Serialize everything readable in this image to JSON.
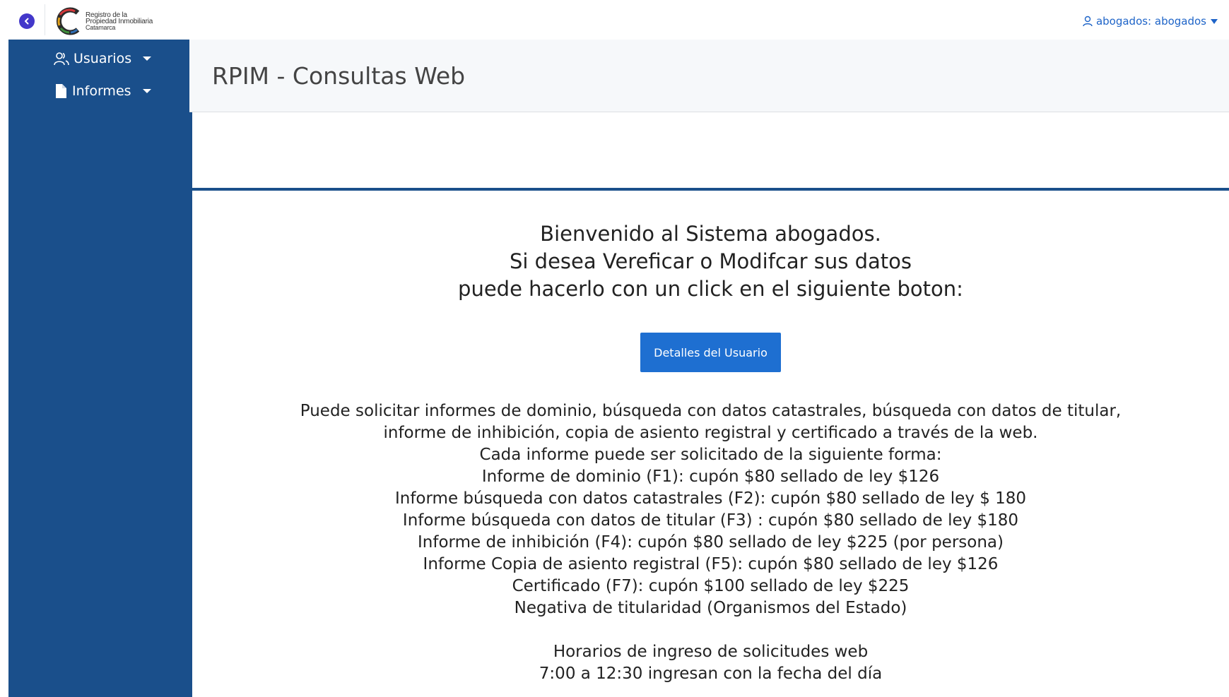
{
  "topbar": {
    "logo_lines": [
      "Registro de la",
      "Propiedad Inmobiliaria",
      "Catamarca"
    ],
    "user_label": "abogados: abogados",
    "icons": {
      "back": "chevron-left-icon",
      "user": "user-icon",
      "dropdown": "caret-down-icon"
    }
  },
  "sidebar": {
    "items": [
      {
        "label": "Usuarios",
        "icon": "users-icon"
      },
      {
        "label": "Informes",
        "icon": "file-icon"
      }
    ]
  },
  "header": {
    "title": "RPIM - Consultas Web"
  },
  "main": {
    "welcome_lines": [
      "Bienvenido al Sistema abogados.",
      "Si desea Vereficar o Modifcar sus datos",
      "puede hacerlo con un click en el siguiente boton:"
    ],
    "details_button": "Detalles del Usuario",
    "info_lines": [
      "Puede solicitar informes de dominio, búsqueda con datos catastrales, búsqueda con datos de titular,",
      "informe de inhibición, copia de asiento registral y certificado a través de la web.",
      "Cada informe puede ser solicitado de la siguiente forma:",
      "Informe de dominio (F1): cupón $80 sellado de ley $126",
      "Informe búsqueda con datos catastrales (F2): cupón $80 sellado de ley $ 180",
      "Informe búsqueda con datos de titular (F3) : cupón $80 sellado de ley $180",
      "Informe de inhibición (F4): cupón $80 sellado de ley $225 (por persona)",
      "Informe Copia de asiento registral (F5): cupón $80 sellado de ley $126",
      "Certificado (F7): cupón $100 sellado de ley $225",
      "Negativa de titularidad (Organismos del Estado)"
    ],
    "hours_lines": [
      "Horarios de ingreso de solicitudes web",
      "7:00 a 12:30 ingresan con la fecha del día"
    ]
  },
  "colors": {
    "sidebar": "#1a4f8b",
    "primary_button": "#1e6fd1",
    "link": "#1e64c8",
    "back_button": "#4338ca"
  }
}
